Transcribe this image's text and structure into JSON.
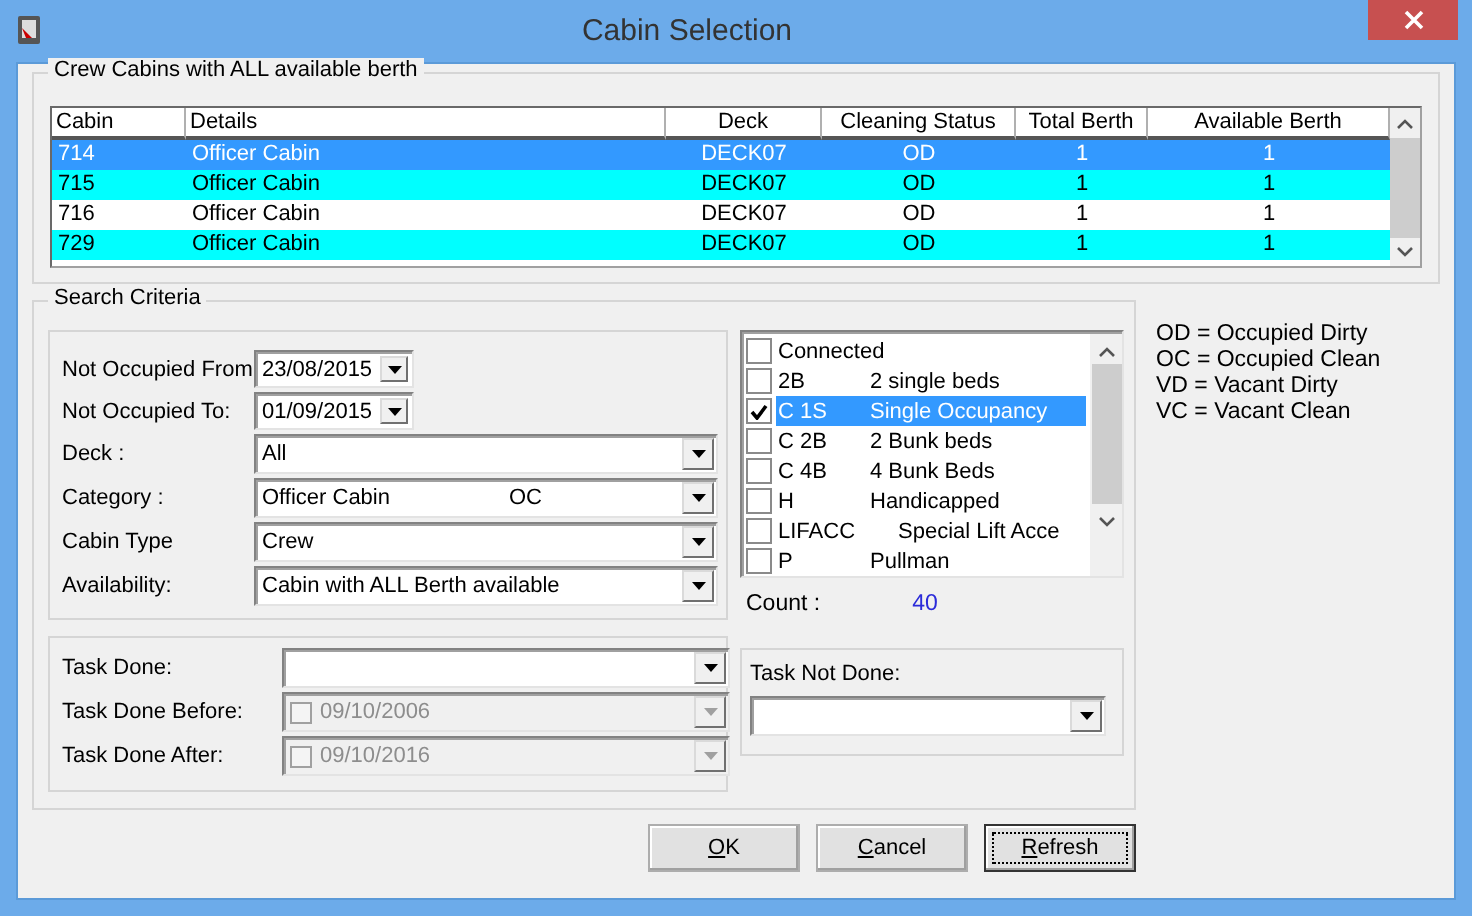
{
  "window": {
    "title": "Cabin Selection"
  },
  "crew_cabins": {
    "title": "Crew Cabins with ALL available berth",
    "columns": [
      "Cabin",
      "Details",
      "Deck",
      "Cleaning Status",
      "Total Berth",
      "Available Berth"
    ],
    "rows": [
      {
        "cells": [
          "714",
          "Officer Cabin",
          "DECK07",
          "OD",
          "1",
          "1"
        ],
        "selected": true,
        "highlighted": false
      },
      {
        "cells": [
          "715",
          "Officer Cabin",
          "DECK07",
          "OD",
          "1",
          "1"
        ],
        "selected": false,
        "highlighted": true
      },
      {
        "cells": [
          "716",
          "Officer Cabin",
          "DECK07",
          "OD",
          "1",
          "1"
        ],
        "selected": false,
        "highlighted": false
      },
      {
        "cells": [
          "729",
          "Officer Cabin",
          "DECK07",
          "OD",
          "1",
          "1"
        ],
        "selected": false,
        "highlighted": true
      }
    ]
  },
  "search_criteria": {
    "title": "Search Criteria",
    "fields": [
      {
        "kind": "date",
        "label": "Not Occupied From",
        "value": "23/08/2015"
      },
      {
        "kind": "date",
        "label": "Not Occupied To:",
        "value": "01/09/2015"
      },
      {
        "kind": "combo",
        "label": "Deck :",
        "value": "All"
      },
      {
        "kind": "combo",
        "label": "Category :",
        "value": "Officer Cabin",
        "code": "OC"
      },
      {
        "kind": "combo",
        "label": "Cabin Type",
        "value": "Crew"
      },
      {
        "kind": "combo",
        "label": "Availability:",
        "value": "Cabin with ALL Berth available"
      }
    ],
    "features": [
      {
        "code": "Connected",
        "checked": false,
        "selected": false
      },
      {
        "code": "2B",
        "description": "2 single beds",
        "checked": false,
        "selected": false
      },
      {
        "code": "C 1S",
        "description": "Single Occupancy",
        "checked": true,
        "selected": true
      },
      {
        "code": "C 2B",
        "description": "2 Bunk beds",
        "checked": false,
        "selected": false
      },
      {
        "code": "C 4B",
        "description": "4 Bunk Beds",
        "checked": false,
        "selected": false
      },
      {
        "code": "H",
        "description": "Handicapped",
        "checked": false,
        "selected": false
      },
      {
        "code": "LIFACC",
        "description": "Special Lift Acce",
        "checked": false,
        "selected": false
      },
      {
        "code": "P",
        "description": "Pullman",
        "checked": false,
        "selected": false
      }
    ],
    "count": {
      "label": "Count :",
      "value": "40"
    },
    "task_fields": [
      {
        "kind": "combo",
        "label": "Task Done:",
        "disabled": false
      },
      {
        "kind": "checkdate",
        "label": "Task Done Before:",
        "value": "09/10/2006",
        "checked": false,
        "disabled": true
      },
      {
        "kind": "checkdate",
        "label": "Task Done After:",
        "value": "09/10/2016",
        "checked": false,
        "disabled": true
      }
    ],
    "task_not_done": {
      "label": "Task Not Done:"
    }
  },
  "legend": [
    "OD = Occupied Dirty",
    "OC = Occupied Clean",
    "VD = Vacant Dirty",
    "VC = Vacant Clean"
  ],
  "buttons": [
    {
      "label": "OK",
      "focused": false
    },
    {
      "label": "Cancel",
      "focused": false
    },
    {
      "label": "Refresh",
      "focused": true
    }
  ]
}
